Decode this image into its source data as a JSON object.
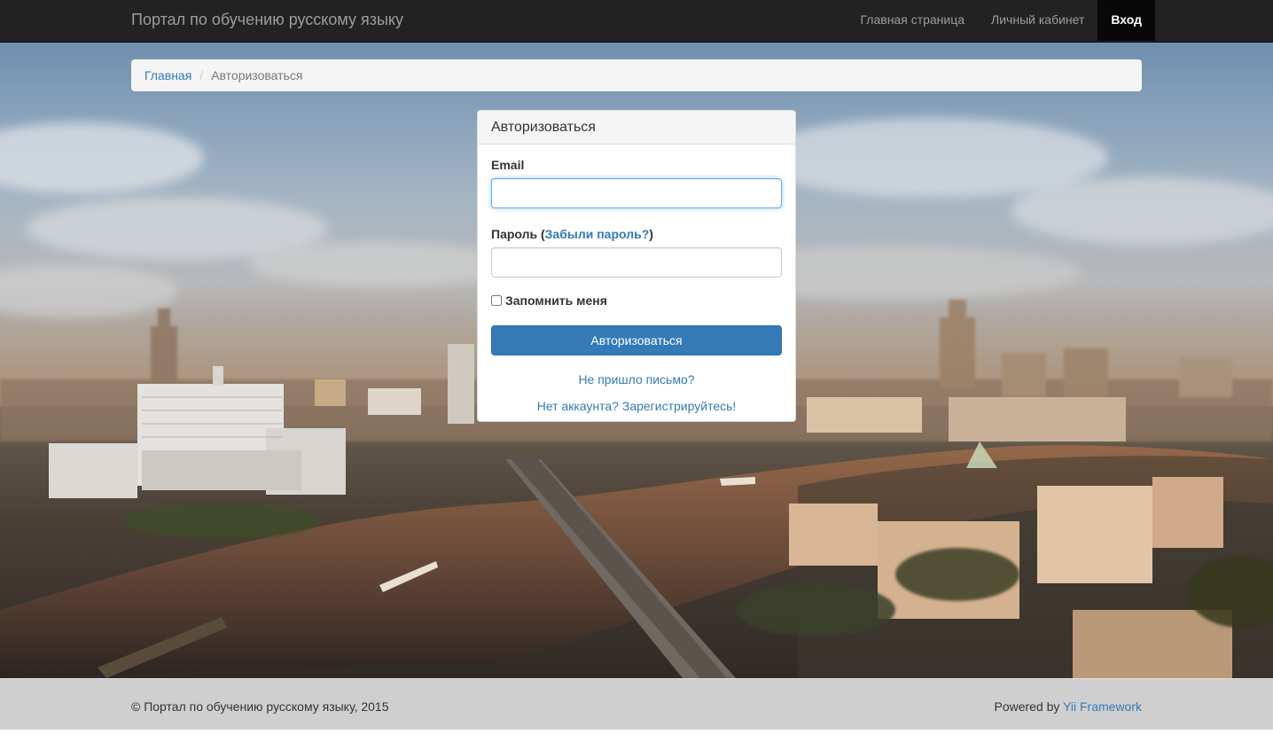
{
  "navbar": {
    "brand": "Портал по обучению русскому языку",
    "items": [
      {
        "label": "Главная страница",
        "active": false
      },
      {
        "label": "Личный кабинет",
        "active": false
      },
      {
        "label": "Вход",
        "active": true
      }
    ]
  },
  "breadcrumb": {
    "home": "Главная",
    "separator": "/",
    "current": "Авторизоваться"
  },
  "login": {
    "title": "Авторизоваться",
    "email_label": "Email",
    "email_value": "",
    "password_label_prefix": "Пароль (",
    "forgot_password_link": "Забыли пароль?",
    "password_label_suffix": ")",
    "password_value": "",
    "remember_me_label": "Запомнить меня",
    "remember_me_checked": false,
    "submit_label": "Авторизоваться",
    "resend_link": "Не пришло письмо?",
    "register_link": "Нет аккаунта? Зарегистрируйтесь!"
  },
  "footer": {
    "copyright": "© Портал по обучению русскому языку, 2015",
    "powered_by_prefix": "Powered by ",
    "powered_by_link": "Yii Framework"
  },
  "colors": {
    "navbar_bg": "#222222",
    "link": "#337ab7",
    "primary_button": "#337ab7",
    "footer_bg": "#cfcfcf"
  }
}
